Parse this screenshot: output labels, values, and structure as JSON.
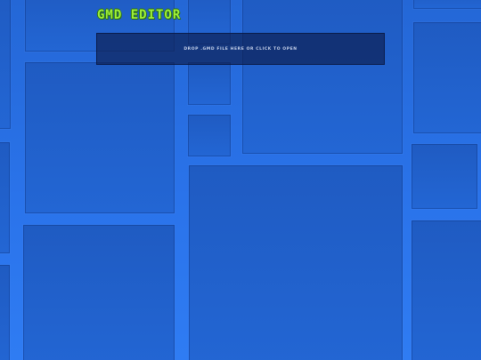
{
  "app": {
    "title": "GMD EDITOR"
  },
  "dropzone": {
    "text": "DROP .GMD FILE HERE OR CLICK TO OPEN"
  },
  "colors": {
    "background": "#2b73e6",
    "tile": "#2366d4",
    "title_text": "#9ef03a",
    "title_outline": "#2b6d0c",
    "dropzone_bg": "#0c1e50",
    "dropzone_text": "#c9d4ec"
  }
}
